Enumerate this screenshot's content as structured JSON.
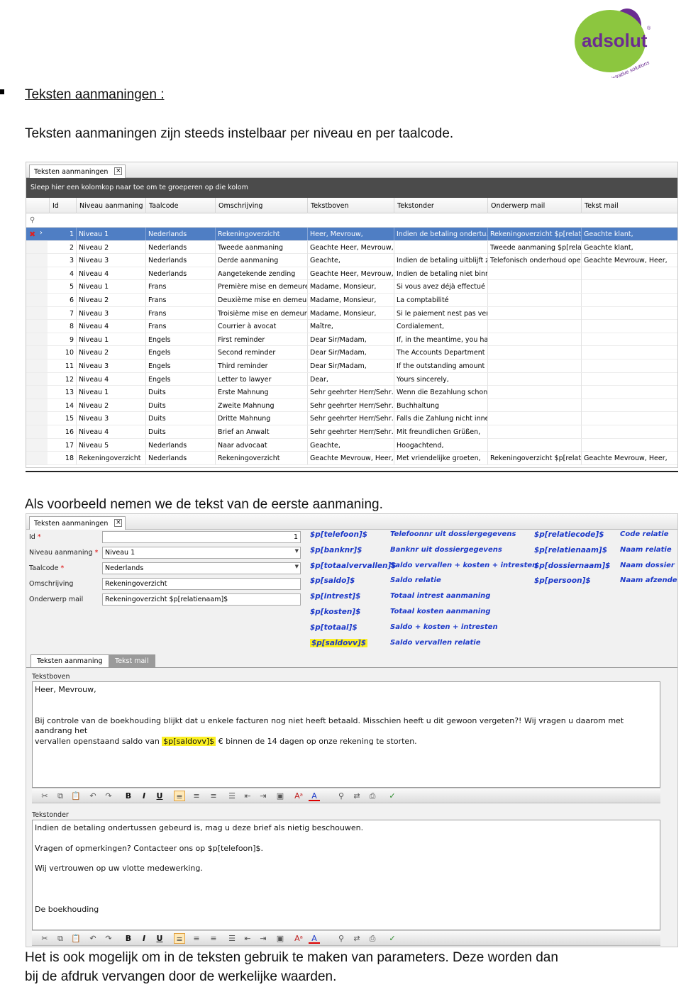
{
  "logo": {
    "brand": "adsolut",
    "tagline": "administrative solutions",
    "colors": {
      "green": "#8cc63f",
      "purple": "#6b2c91"
    }
  },
  "heading": "Teksten aanmaningen :",
  "intro": "Teksten aanmaningen zijn steeds instelbaar per niveau en per taalcode.",
  "example_text": "Als voorbeeld nemen we de tekst van de eerste aanmaning.",
  "outro_line1": "Het is ook mogelijk om in de teksten gebruik te maken van parameters. Deze worden dan",
  "outro_line2": "bij de afdruk vervangen door de werkelijke waarden.",
  "grid": {
    "tab_label": "Teksten aanmaningen",
    "group_hint": "Sleep hier een kolomkop naar toe om te groeperen op die kolom",
    "columns": [
      "Id",
      "Niveau aanmaning",
      "Taalcode",
      "Omschrijving",
      "Tekstboven",
      "Tekstonder",
      "Onderwerp mail",
      "Tekst mail"
    ],
    "rows": [
      [
        "1",
        "Niveau 1",
        "Nederlands",
        "Rekeningoverzicht",
        "Heer, Mevrouw,",
        "Indien de betaling ondertu…",
        "Rekeningoverzicht $p[relat…",
        "Geachte klant,"
      ],
      [
        "2",
        "Niveau 2",
        "Nederlands",
        "Tweede aanmaning",
        "Geachte Heer, Mevrouw,",
        "",
        "Tweede aanmaning $p[rela…",
        "Geachte klant,"
      ],
      [
        "3",
        "Niveau 3",
        "Nederlands",
        "Derde aanmaning",
        "Geachte,",
        "Indien de betaling uitblijft z…",
        "Telefonisch onderhoud ope…",
        "Geachte Mevrouw, Heer,"
      ],
      [
        "4",
        "Niveau 4",
        "Nederlands",
        "Aangetekende zending",
        "Geachte Heer, Mevrouw,",
        "Indien de betaling niet binn…",
        "",
        ""
      ],
      [
        "5",
        "Niveau 1",
        "Frans",
        "Première mise en demeure",
        "Madame, Monsieur,",
        "Si vous avez déjà effectué …",
        "",
        ""
      ],
      [
        "6",
        "Niveau 2",
        "Frans",
        "Deuxième mise en demeure",
        "Madame, Monsieur,",
        "La comptabilité",
        "",
        ""
      ],
      [
        "7",
        "Niveau 3",
        "Frans",
        "Troisième mise en demeure",
        "Madame, Monsieur,",
        "Si le paiement nest pas ver…",
        "",
        ""
      ],
      [
        "8",
        "Niveau 4",
        "Frans",
        "Courrier à avocat",
        "Maître,",
        "Cordialement,",
        "",
        ""
      ],
      [
        "9",
        "Niveau 1",
        "Engels",
        "First reminder",
        "Dear Sir/Madam,",
        "If, in the meantime, you ha…",
        "",
        ""
      ],
      [
        "10",
        "Niveau 2",
        "Engels",
        "Second reminder",
        "Dear Sir/Madam,",
        "The Accounts Department",
        "",
        ""
      ],
      [
        "11",
        "Niveau 3",
        "Engels",
        "Third reminder",
        "Dear Sir/Madam,",
        "If the outstanding amount i…",
        "",
        ""
      ],
      [
        "12",
        "Niveau 4",
        "Engels",
        "Letter to lawyer",
        "Dear,",
        "Yours sincerely,",
        "",
        ""
      ],
      [
        "13",
        "Niveau 1",
        "Duits",
        "Erste Mahnung",
        "Sehr geehrter Herr/Sehr…",
        "Wenn die Bezahlung schon …",
        "",
        ""
      ],
      [
        "14",
        "Niveau 2",
        "Duits",
        "Zweite Mahnung",
        "Sehr geehrter Herr/Sehr…",
        "Buchhaltung",
        "",
        ""
      ],
      [
        "15",
        "Niveau 3",
        "Duits",
        "Dritte Mahnung",
        "Sehr geehrter Herr/Sehr…",
        "Falls die Zahlung nicht inne…",
        "",
        ""
      ],
      [
        "16",
        "Niveau 4",
        "Duits",
        "Brief an Anwalt",
        "Sehr geehrter Herr/Sehr…",
        "Mit freundlichen Grüßen,",
        "",
        ""
      ],
      [
        "17",
        "Niveau 5",
        "Nederlands",
        "Naar advocaat",
        "Geachte,",
        "Hoogachtend,",
        "",
        ""
      ],
      [
        "18",
        "Rekeningoverzicht",
        "Nederlands",
        "Rekeningoverzicht",
        "Geachte Mevrouw, Heer,",
        "Met vriendelijke groeten,",
        "Rekeningoverzicht $p[relat…",
        "Geachte Mevrouw, Heer,"
      ]
    ]
  },
  "detail": {
    "tab_label": "Teksten aanmaningen",
    "fields": {
      "id": {
        "label": "Id",
        "value": "1"
      },
      "niveau": {
        "label": "Niveau aanmaning",
        "value": "Niveau 1"
      },
      "taalcode": {
        "label": "Taalcode",
        "value": "Nederlands"
      },
      "omschrijving": {
        "label": "Omschrijving",
        "value": "Rekeningoverzicht"
      },
      "onderwerp": {
        "label": "Onderwerp mail",
        "value": "Rekeningoverzicht $p[relatienaam]$"
      }
    },
    "params_col1": [
      "$p[telefoon]$",
      "$p[banknr]$",
      "$p[totaalvervallen]$",
      "$p[saldo]$",
      "$p[intrest]$",
      "$p[kosten]$",
      "$p[totaal]$",
      "$p[saldovv]$"
    ],
    "params_col2": [
      "Telefoonnr uit dossiergegevens",
      "Banknr uit dossiergegevens",
      "Saldo vervallen + kosten + intresten",
      "Saldo relatie",
      "Totaal intrest aanmaning",
      "Totaal kosten aanmaning",
      "Saldo + kosten + intresten",
      "Saldo vervallen relatie"
    ],
    "params_col3": [
      "$p[relatiecode]$",
      "$p[relatienaam]$",
      "$p[dossiernaam]$",
      "$p[persoon]$"
    ],
    "params_col4": [
      "Code relatie",
      "Naam relatie",
      "Naam dossier",
      "Naam afzender"
    ],
    "subtabs": [
      "Teksten aanmaning",
      "Tekst mail"
    ],
    "tekstboven_label": "Tekstboven",
    "tekstboven": {
      "line1": "Heer, Mevrouw,",
      "line2": "Bij controle van de boekhouding blijkt dat u enkele facturen nog niet heeft betaald. Misschien heeft u dit gewoon vergeten?! Wij vragen u daarom met aandrang het",
      "line3_pre": "vervallen openstaand saldo van ",
      "line3_param": "$p[saldovv]$",
      "line3_post": " € binnen de 14 dagen op onze rekening te storten."
    },
    "tekstonder_label": "Tekstonder",
    "tekstonder": {
      "line1": "Indien de betaling ondertussen gebeurd is, mag u deze brief als nietig beschouwen.",
      "line2": "Vragen of opmerkingen? Contacteer ons op $p[telefoon]$.",
      "line3": "Wij vertrouwen op uw vlotte medewerking.",
      "line4": "De boekhouding"
    },
    "highlight_color": "#fbef22",
    "param_color": "#1c39c9"
  }
}
